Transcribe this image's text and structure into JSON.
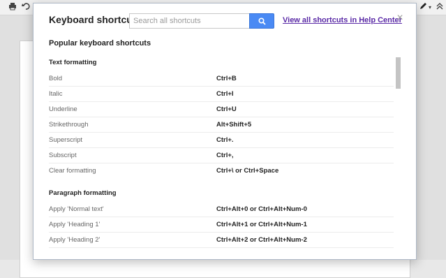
{
  "dialog": {
    "title": "Keyboard shortcuts",
    "search_placeholder": "Search all shortcuts",
    "help_link": "View all shortcuts in Help Center",
    "close_label": "×",
    "subtitle": "Popular keyboard shortcuts"
  },
  "sections": [
    {
      "title": "Text formatting",
      "rows": [
        {
          "name": "Bold",
          "keys": "Ctrl+B"
        },
        {
          "name": "Italic",
          "keys": "Ctrl+I"
        },
        {
          "name": "Underline",
          "keys": "Ctrl+U"
        },
        {
          "name": "Strikethrough",
          "keys": "Alt+Shift+5"
        },
        {
          "name": "Superscript",
          "keys": "Ctrl+."
        },
        {
          "name": "Subscript",
          "keys": "Ctrl+,"
        },
        {
          "name": "Clear formatting",
          "keys": "Ctrl+\\ or Ctrl+Space"
        }
      ]
    },
    {
      "title": "Paragraph formatting",
      "rows": [
        {
          "name": "Apply 'Normal text'",
          "keys": "Ctrl+Alt+0 or Ctrl+Alt+Num-0"
        },
        {
          "name": "Apply 'Heading 1'",
          "keys": "Ctrl+Alt+1 or Ctrl+Alt+Num-1"
        },
        {
          "name": "Apply 'Heading 2'",
          "keys": "Ctrl+Alt+2 or Ctrl+Alt+Num-2"
        }
      ]
    }
  ],
  "colors": {
    "search_button": "#4a8af4",
    "help_link": "#5a2aa6"
  }
}
